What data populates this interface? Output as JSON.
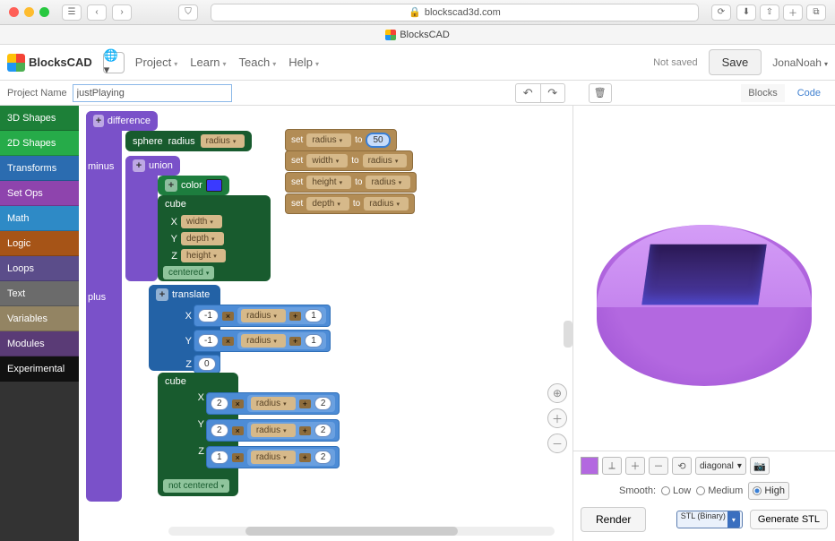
{
  "browser": {
    "url": "blockscad3d.com",
    "tab_title": "BlocksCAD"
  },
  "app": {
    "title": "BlocksCAD",
    "menus": [
      "Project",
      "Learn",
      "Teach",
      "Help"
    ],
    "saved_status": "Not saved",
    "save_label": "Save",
    "user": "JonaNoah",
    "project_label": "Project Name",
    "project_name": "justPlaying",
    "tab_blocks": "Blocks",
    "tab_code": "Code"
  },
  "sidebar": {
    "items": [
      "3D Shapes",
      "2D Shapes",
      "Transforms",
      "Set Ops",
      "Math",
      "Logic",
      "Loops",
      "Text",
      "Variables",
      "Modules",
      "Experimental"
    ]
  },
  "blocks": {
    "difference": "difference",
    "minus": "minus",
    "plus": "plus",
    "union": "union",
    "color": "color",
    "translate": "translate",
    "sphere": "sphere",
    "radius": "radius",
    "cube": "cube",
    "centered": "centered",
    "not_centered": "not centered",
    "set": "set",
    "to": "to",
    "vars": {
      "radius": "radius",
      "width": "width",
      "height": "height",
      "depth": "depth"
    },
    "axes": {
      "x": "X",
      "y": "Y",
      "z": "Z"
    },
    "set_rows": [
      {
        "var": "radius",
        "val": "50",
        "hl": true
      },
      {
        "var": "width",
        "val_var": "radius"
      },
      {
        "var": "height",
        "val_var": "radius"
      },
      {
        "var": "depth",
        "val_var": "radius"
      }
    ],
    "cube1": {
      "x_var": "width",
      "y_var": "depth",
      "z_var": "height"
    },
    "trans": {
      "x": {
        "a": "-1",
        "op1": "×",
        "var": "radius",
        "op2": "+",
        "b": "1"
      },
      "y": {
        "a": "-1",
        "op1": "×",
        "var": "radius",
        "op2": "+",
        "b": "1"
      },
      "z": "0"
    },
    "cube2": {
      "x": {
        "a": "2",
        "op1": "×",
        "var": "radius",
        "op2": "+",
        "b": "2"
      },
      "y": {
        "a": "2",
        "op1": "×",
        "var": "radius",
        "op2": "+",
        "b": "2"
      },
      "z": {
        "a": "1",
        "op1": "×",
        "var": "radius",
        "op2": "+",
        "b": "2"
      }
    }
  },
  "viewer": {
    "view_select": "diagonal",
    "smooth_label": "Smooth:",
    "smooth": [
      "Low",
      "Medium",
      "High"
    ],
    "smooth_selected": "High",
    "render": "Render",
    "stl_format": "STL (Binary)",
    "gen": "Generate STL"
  }
}
